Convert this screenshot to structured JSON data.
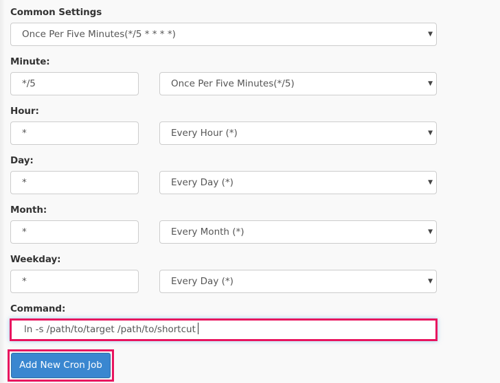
{
  "form": {
    "common_settings": {
      "label": "Common Settings",
      "selected": "Once Per Five Minutes(*/5 * * * *)"
    },
    "fields": [
      {
        "label": "Minute:",
        "value": "*/5",
        "select": "Once Per Five Minutes(*/5)"
      },
      {
        "label": "Hour:",
        "value": "*",
        "select": "Every Hour (*)"
      },
      {
        "label": "Day:",
        "value": "*",
        "select": "Every Day (*)"
      },
      {
        "label": "Month:",
        "value": "*",
        "select": "Every Month (*)"
      },
      {
        "label": "Weekday:",
        "value": "*",
        "select": "Every Day (*)"
      }
    ],
    "command": {
      "label": "Command:",
      "value": "ln -s /path/to/target /path/to/shortcut"
    },
    "submit_label": "Add New Cron Job",
    "arrow_glyph": "▼"
  },
  "colors": {
    "highlight": "#e8145e",
    "primary_button": "#3a87d0"
  }
}
